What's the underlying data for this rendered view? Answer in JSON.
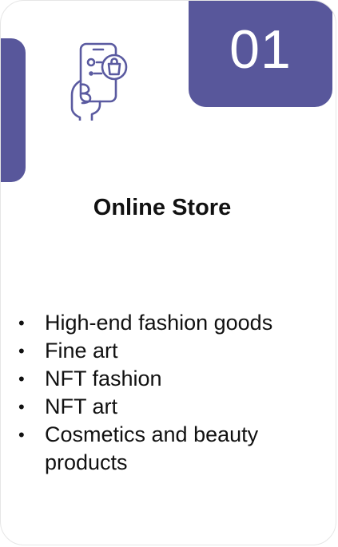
{
  "card": {
    "number": "01",
    "icon": "mobile-shopping-icon",
    "title": "Online Store",
    "items": [
      "High-end fashion goods",
      "Fine art",
      "NFT fashion",
      "NFT art",
      "Cosmetics and beauty products"
    ]
  },
  "colors": {
    "accent": "#58579b",
    "icon_stroke": "#5a5aa0",
    "text": "#111111"
  }
}
